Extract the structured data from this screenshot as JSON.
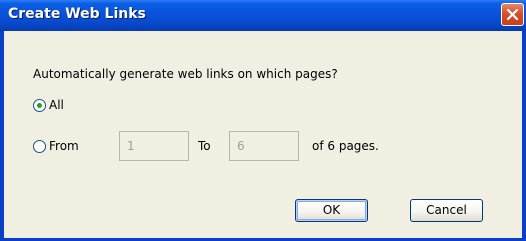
{
  "window": {
    "title": "Create Web Links"
  },
  "dialog": {
    "prompt": "Automatically generate web links on which pages?",
    "option_all_label": "All",
    "option_from_label": "From",
    "from_value": "1",
    "to_label": "To",
    "to_value": "6",
    "pages_suffix": "of 6 pages.",
    "selected_option": "All"
  },
  "buttons": {
    "ok_label": "OK",
    "cancel_label": "Cancel"
  },
  "colors": {
    "titlebar": "#0a52dc",
    "close_button": "#d5512a",
    "dialog_background": "#f1efe2",
    "radio_selected_dot": "#21a121"
  },
  "icons": {
    "close": "close-icon"
  }
}
